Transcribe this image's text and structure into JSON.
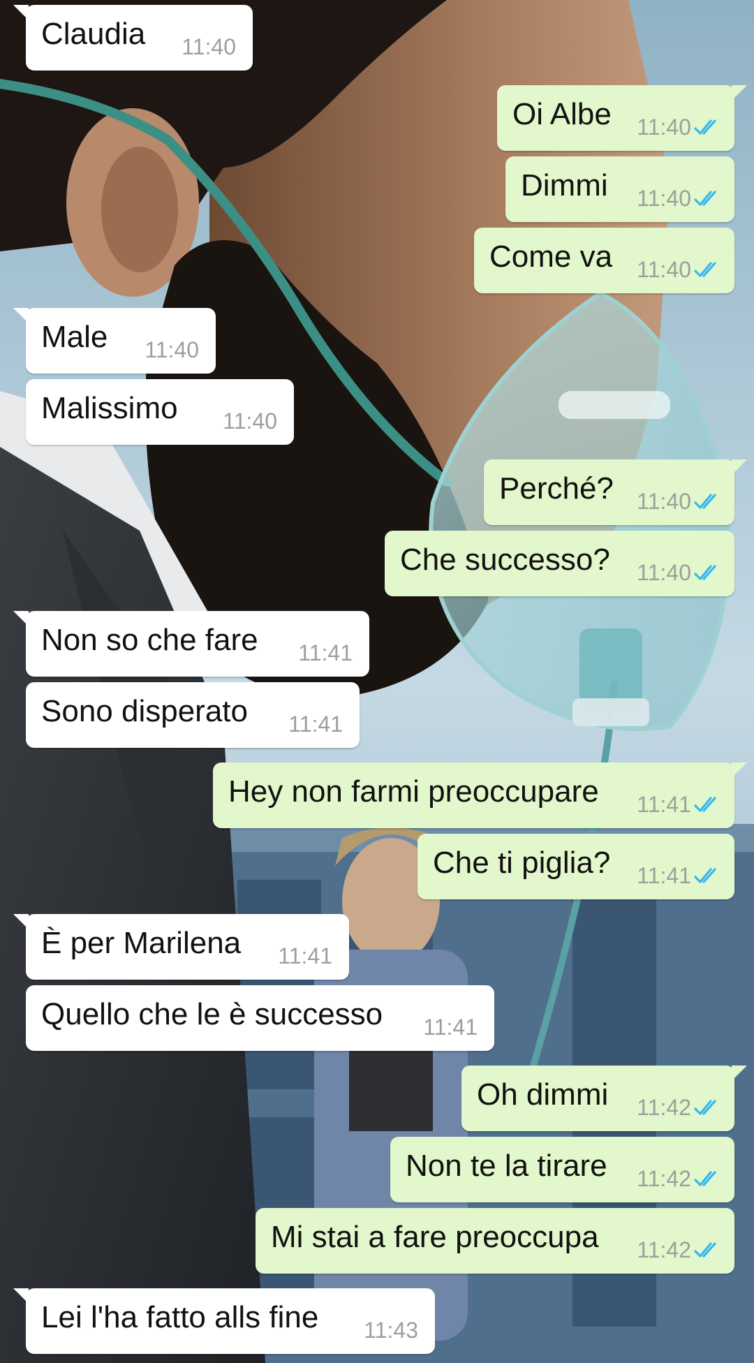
{
  "colors": {
    "incoming_bubble": "#ffffff",
    "outgoing_bubble": "#e2f7cb",
    "timestamp": "#9aa09a",
    "read_ticks": "#34b7f1"
  },
  "messages": [
    {
      "dir": "in",
      "text": "Claudia",
      "time": "11:40"
    },
    {
      "dir": "out",
      "text": "Oi Albe",
      "time": "11:40",
      "ticks": "read-ticks-icon"
    },
    {
      "dir": "out",
      "text": "Dimmi",
      "time": "11:40",
      "ticks": "read-ticks-icon"
    },
    {
      "dir": "out",
      "text": "Come va",
      "time": "11:40",
      "ticks": "read-ticks-icon"
    },
    {
      "dir": "in",
      "text": "Male",
      "time": "11:40"
    },
    {
      "dir": "in",
      "text": "Malissimo",
      "time": "11:40"
    },
    {
      "dir": "out",
      "text": "Perché?",
      "time": "11:40",
      "ticks": "read-ticks-icon"
    },
    {
      "dir": "out",
      "text": "Che successo?",
      "time": "11:40",
      "ticks": "read-ticks-icon"
    },
    {
      "dir": "in",
      "text": "Non so che fare",
      "time": "11:41"
    },
    {
      "dir": "in",
      "text": "Sono disperato",
      "time": "11:41"
    },
    {
      "dir": "out",
      "text": "Hey non farmi preoccupare",
      "time": "11:41",
      "ticks": "read-ticks-icon"
    },
    {
      "dir": "out",
      "text": "Che ti piglia?",
      "time": "11:41",
      "ticks": "read-ticks-icon"
    },
    {
      "dir": "in",
      "text": "È per Marilena",
      "time": "11:41"
    },
    {
      "dir": "in",
      "text": "Quello che le è successo",
      "time": "11:41"
    },
    {
      "dir": "out",
      "text": "Oh dimmi",
      "time": "11:42",
      "ticks": "read-ticks-icon"
    },
    {
      "dir": "out",
      "text": "Non te la tirare",
      "time": "11:42",
      "ticks": "read-ticks-icon"
    },
    {
      "dir": "out",
      "text": "Mi stai a fare preoccupa",
      "time": "11:42",
      "ticks": "read-ticks-icon"
    },
    {
      "dir": "in",
      "text": "Lei l'ha fatto alls fine",
      "time": "11:43"
    }
  ]
}
